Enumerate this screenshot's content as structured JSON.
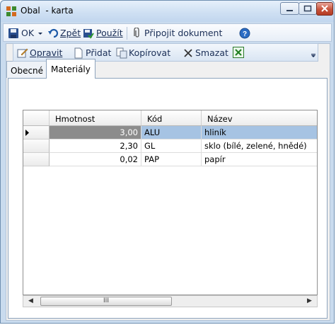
{
  "window": {
    "title": "Obal  - karta"
  },
  "toolbar": {
    "ok_label": "OK",
    "back_label": "Zpět",
    "apply_label": "Použít",
    "attach_label": "Připojit dokument"
  },
  "tabs": [
    {
      "label": "Obecné",
      "active": false
    },
    {
      "label": "Materiály",
      "active": true
    }
  ],
  "grid_toolbar": {
    "edit_label": "Opravit",
    "add_label": "Přidat",
    "copy_label": "Kopírovat",
    "delete_label": "Smazat"
  },
  "grid": {
    "columns": [
      "Hmotnost",
      "Kód",
      "Název"
    ],
    "rows": [
      {
        "weight": "3,00",
        "code": "ALU",
        "name": "hliník",
        "selected": true
      },
      {
        "weight": "2,30",
        "code": "GL",
        "name": "sklo (bílé, zelené, hnědé)",
        "selected": false
      },
      {
        "weight": "0,02",
        "code": "PAP",
        "name": "papír",
        "selected": false
      }
    ],
    "row_indicator": "▸"
  },
  "scrollbar": {
    "thumb_grip": "III"
  },
  "icons": [
    "app-icon",
    "save-icon",
    "dropdown-icon",
    "undo-icon",
    "apply-icon",
    "attach-icon",
    "help-icon",
    "edit-icon",
    "add-icon",
    "copy-icon",
    "delete-icon",
    "excel-icon",
    "overflow-icon"
  ],
  "colors": {
    "selection": "#a6c3e3",
    "selection_value": "#8c8c8c",
    "title_gradient": "#cfe0f3",
    "close": "#c7523a"
  }
}
